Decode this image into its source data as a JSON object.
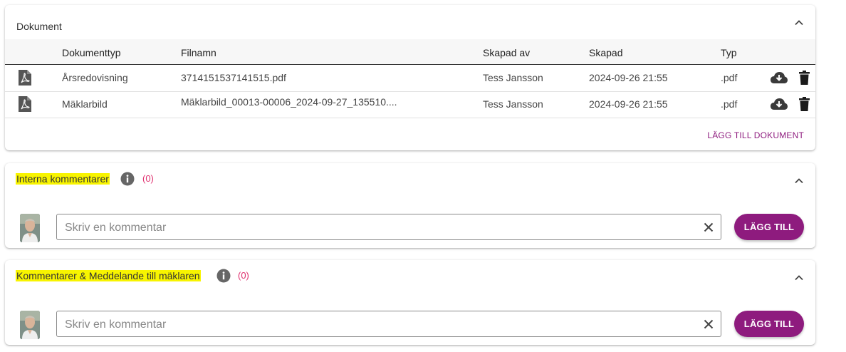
{
  "documents": {
    "title": "Dokument",
    "columns": {
      "type": "Dokumenttyp",
      "filename": "Filnamn",
      "created_by": "Skapad av",
      "created": "Skapad",
      "ext": "Typ"
    },
    "rows": [
      {
        "type": "Årsredovisning",
        "filename": "3714151537141515.pdf",
        "created_by": "Tess Jansson",
        "created": "2024-09-26 21:55",
        "ext": ".pdf"
      },
      {
        "type": "Mäklarbild",
        "filename": "Mäklarbild_00013-00006_2024-09-27_135510....",
        "created_by": "Tess Jansson",
        "created": "2024-09-26 21:55",
        "ext": ".pdf"
      }
    ],
    "add_label": "LÄGG TILL DOKUMENT",
    "icons": [
      "pdf-file-icon",
      "cloud-download-icon",
      "trash-icon",
      "chevron-up-icon"
    ]
  },
  "internal_comments": {
    "title": "Interna kommentarer",
    "count": "(0)",
    "placeholder": "Skriv en kommentar",
    "value": "",
    "button_label": "LÄGG TILL"
  },
  "broker_comments": {
    "title": "Kommentarer & Meddelande till mäklaren",
    "count": "(0)",
    "placeholder": "Skriv en kommentar",
    "value": "",
    "button_label": "LÄGG TILL"
  },
  "colors": {
    "accent": "#8e1b7e",
    "count": "#e0306f",
    "highlight": "#f8f400"
  }
}
